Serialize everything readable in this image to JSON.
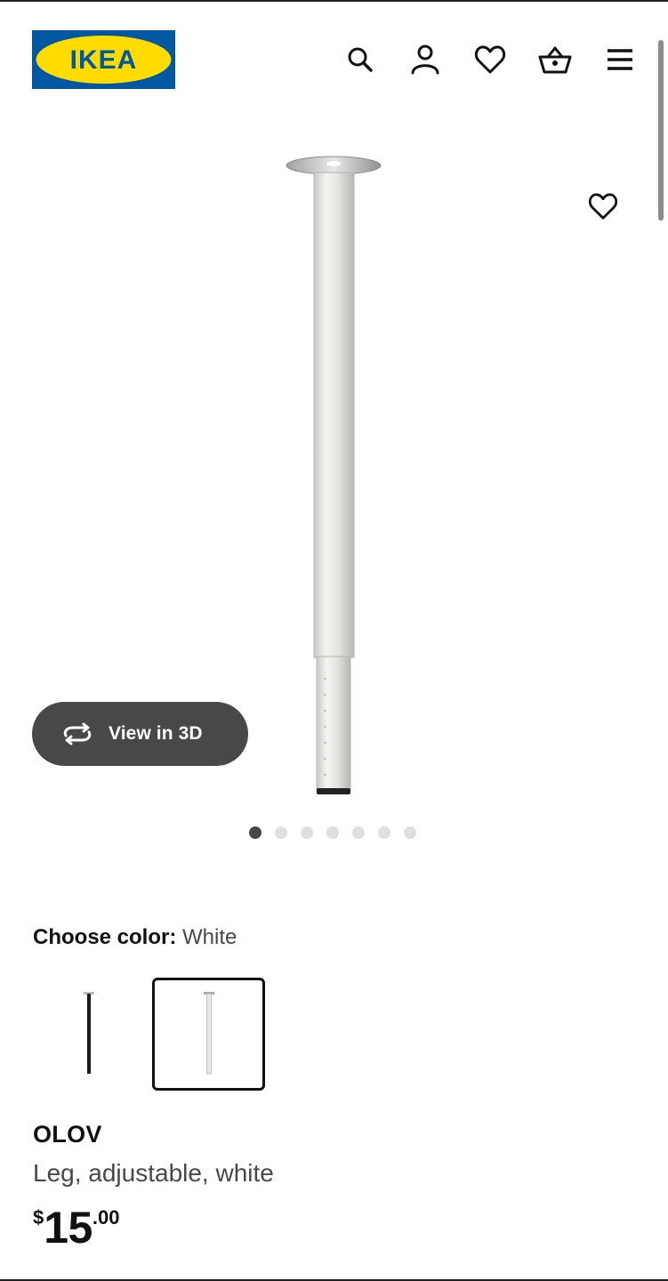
{
  "brand": {
    "logo_text": "IKEA",
    "colors": {
      "blue": "#0058A3",
      "yellow": "#FFDB00"
    }
  },
  "header": {
    "icons": [
      "search-icon",
      "account-icon",
      "favorites-icon",
      "basket-icon",
      "menu-icon"
    ]
  },
  "gallery": {
    "view_3d_label": "View in 3D",
    "image_count": 7,
    "active_index": 0
  },
  "color_chooser": {
    "label": "Choose color:",
    "selected_value": "White",
    "options": [
      "Black",
      "White"
    ]
  },
  "product": {
    "name": "OLOV",
    "description": "Leg, adjustable, white",
    "price": {
      "currency": "$",
      "integer": "15",
      "decimal": ".00"
    }
  }
}
